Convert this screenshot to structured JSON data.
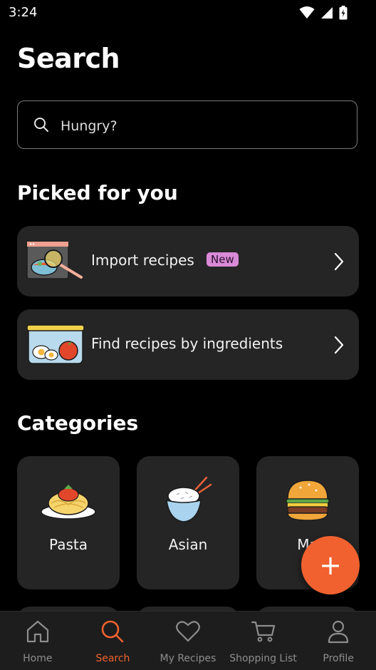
{
  "status": {
    "time": "3:24",
    "icons": [
      "wifi-icon",
      "signal-icon",
      "battery-charging-icon"
    ]
  },
  "page": {
    "title": "Search"
  },
  "search": {
    "placeholder": "Hungry?",
    "value": ""
  },
  "picked": {
    "title": "Picked for you",
    "items": [
      {
        "label": "Import recipes",
        "badge": "New",
        "icon": "import-recipes-illustration"
      },
      {
        "label": "Find recipes by ingredients",
        "icon": "ingredients-illustration"
      }
    ]
  },
  "categories": {
    "title": "Categories",
    "items": [
      {
        "label": "Pasta",
        "icon": "pasta-illustration"
      },
      {
        "label": "Asian",
        "icon": "rice-bowl-illustration"
      },
      {
        "label": "Ma",
        "icon": "burger-illustration"
      }
    ]
  },
  "fab": {
    "label": "+",
    "icon": "plus-icon"
  },
  "nav": {
    "items": [
      {
        "label": "Home",
        "icon": "home-icon"
      },
      {
        "label": "Search",
        "icon": "search-icon",
        "active": true
      },
      {
        "label": "My Recipes",
        "icon": "heart-icon"
      },
      {
        "label": "Shopping List",
        "icon": "cart-icon"
      },
      {
        "label": "Profile",
        "icon": "person-icon"
      }
    ]
  },
  "colors": {
    "background": "#000000",
    "card": "#252525",
    "accent": "#f0612f",
    "badge": "#d98ad6",
    "nav_background": "#1d1d1d",
    "nav_inactive": "#8d8d8d"
  }
}
